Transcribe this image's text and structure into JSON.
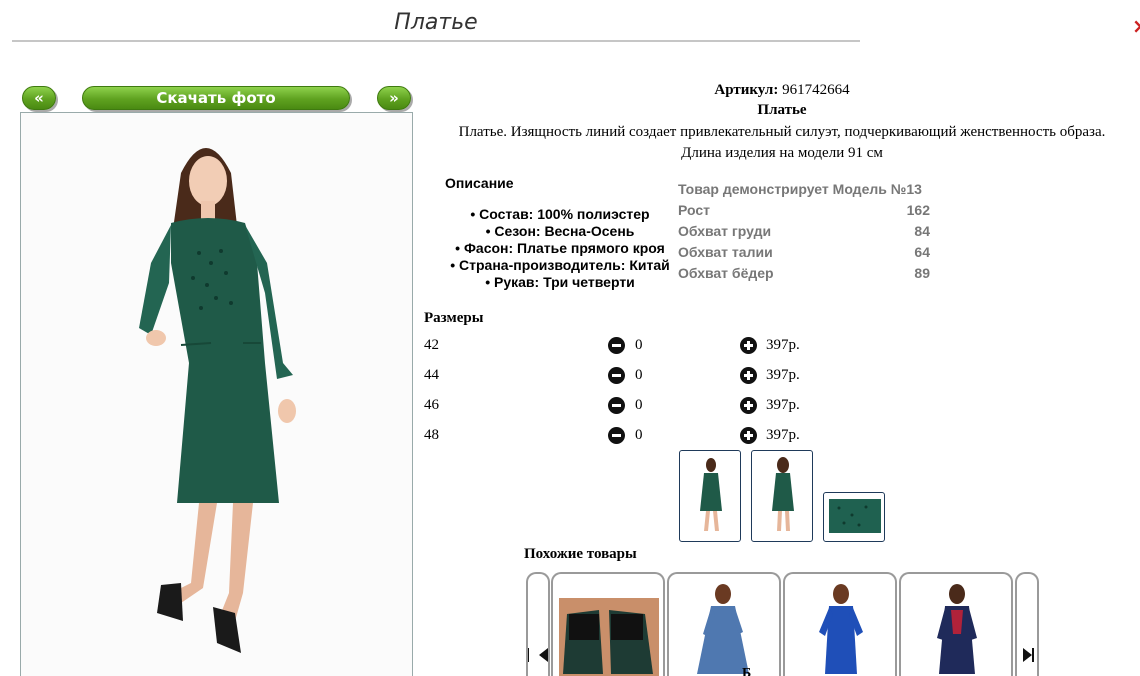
{
  "header": {
    "title": "Платье",
    "close_glyph": "×"
  },
  "nav": {
    "prev_label": "«",
    "download_label": "Скачать фото",
    "next_label": "»"
  },
  "product": {
    "article_label": "Артикул:",
    "article_value": "961742664",
    "name": "Платье",
    "description_line1": "Платье. Изящность линий создает привлекательный силуэт, подчеркивающий женственность образа.",
    "description_line2": "Длина изделия на модели 91 см"
  },
  "description": {
    "title": "Описание",
    "items": [
      "• Состав: 100% полиэстер",
      "• Сезон: Весна-Осень",
      "• Фасон: Платье прямого кроя",
      "• Страна-производитель: Китай",
      "• Рукав: Три четверти"
    ]
  },
  "model": {
    "heading": "Товар демонстрирует Модель №13",
    "rows": [
      {
        "label": "Рост",
        "value": "162"
      },
      {
        "label": "Обхват груди",
        "value": "84"
      },
      {
        "label": "Обхват талии",
        "value": "64"
      },
      {
        "label": "Обхват бёдер",
        "value": "89"
      }
    ]
  },
  "sizes": {
    "title": "Размеры",
    "rows": [
      {
        "size": "42",
        "qty": "0",
        "price": "397р."
      },
      {
        "size": "44",
        "qty": "0",
        "price": "397р."
      },
      {
        "size": "46",
        "qty": "0",
        "price": "397р."
      },
      {
        "size": "48",
        "qty": "0",
        "price": "397р."
      }
    ]
  },
  "similar": {
    "title": "Похожие товары",
    "cut_text": "Б"
  },
  "colors": {
    "accent_green": "#5fa220",
    "dress_green": "#1f5a48",
    "thumb_border": "#1f3a5a"
  },
  "icons": [
    "minus-circle-icon",
    "plus-circle-icon",
    "carousel-prev-icon",
    "carousel-next-icon"
  ]
}
